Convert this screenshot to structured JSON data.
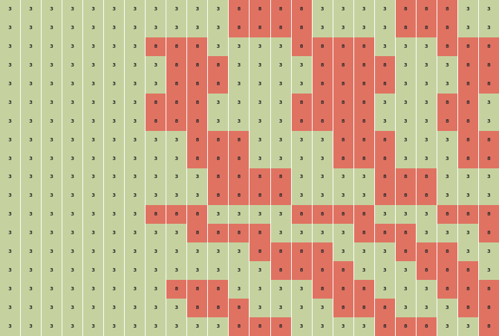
{
  "colors": {
    "value_3": "#c5d29f",
    "value_8": "#e07262"
  },
  "grid": {
    "rows": [
      [
        3,
        3,
        3,
        3,
        3,
        3,
        3,
        3,
        3,
        3,
        3,
        8,
        8,
        8,
        8,
        3,
        3,
        3,
        3,
        8,
        8,
        8,
        3,
        3
      ],
      [
        3,
        3,
        3,
        3,
        3,
        3,
        3,
        3,
        3,
        3,
        3,
        8,
        8,
        8,
        8,
        3,
        3,
        3,
        3,
        8,
        8,
        8,
        3,
        3
      ],
      [
        3,
        3,
        3,
        3,
        3,
        3,
        3,
        8,
        8,
        8,
        3,
        3,
        3,
        3,
        8,
        8,
        8,
        8,
        3,
        3,
        3,
        8,
        8,
        8
      ],
      [
        3,
        3,
        3,
        3,
        3,
        3,
        3,
        3,
        8,
        8,
        8,
        3,
        3,
        3,
        3,
        8,
        8,
        8,
        8,
        3,
        3,
        3,
        8,
        8
      ],
      [
        3,
        3,
        3,
        3,
        3,
        3,
        3,
        3,
        8,
        8,
        8,
        3,
        3,
        3,
        3,
        8,
        8,
        8,
        8,
        3,
        3,
        3,
        8,
        8
      ],
      [
        3,
        3,
        3,
        3,
        3,
        3,
        3,
        8,
        8,
        8,
        3,
        3,
        3,
        3,
        8,
        8,
        8,
        8,
        3,
        3,
        3,
        8,
        8,
        3
      ],
      [
        3,
        3,
        3,
        3,
        3,
        3,
        3,
        8,
        8,
        8,
        3,
        3,
        3,
        3,
        8,
        8,
        8,
        8,
        3,
        3,
        3,
        8,
        8,
        3
      ],
      [
        3,
        3,
        3,
        3,
        3,
        3,
        3,
        3,
        3,
        8,
        8,
        8,
        3,
        3,
        3,
        3,
        8,
        8,
        8,
        3,
        3,
        3,
        8,
        8
      ],
      [
        3,
        3,
        3,
        3,
        3,
        3,
        3,
        3,
        3,
        8,
        8,
        8,
        3,
        3,
        3,
        3,
        8,
        8,
        8,
        3,
        3,
        3,
        8,
        8
      ],
      [
        3,
        3,
        3,
        3,
        3,
        3,
        3,
        3,
        3,
        3,
        8,
        8,
        8,
        8,
        3,
        3,
        3,
        3,
        8,
        8,
        8,
        3,
        3,
        3
      ],
      [
        3,
        3,
        3,
        3,
        3,
        3,
        3,
        3,
        3,
        3,
        8,
        8,
        8,
        8,
        3,
        3,
        3,
        3,
        8,
        8,
        8,
        3,
        3,
        3
      ],
      [
        3,
        3,
        3,
        3,
        3,
        3,
        3,
        8,
        8,
        8,
        3,
        3,
        3,
        3,
        8,
        8,
        8,
        8,
        3,
        3,
        3,
        8,
        8,
        8
      ],
      [
        3,
        3,
        3,
        3,
        3,
        3,
        3,
        3,
        3,
        8,
        8,
        8,
        8,
        3,
        3,
        3,
        3,
        8,
        8,
        8,
        3,
        3,
        3,
        8
      ],
      [
        3,
        3,
        3,
        3,
        3,
        3,
        3,
        3,
        3,
        3,
        3,
        3,
        8,
        8,
        8,
        8,
        3,
        3,
        3,
        8,
        8,
        8,
        3,
        3
      ],
      [
        3,
        3,
        3,
        3,
        3,
        3,
        3,
        3,
        3,
        3,
        3,
        3,
        3,
        8,
        8,
        8,
        8,
        3,
        3,
        3,
        8,
        8,
        8,
        3
      ],
      [
        3,
        3,
        3,
        3,
        3,
        3,
        3,
        3,
        8,
        8,
        8,
        3,
        3,
        3,
        3,
        8,
        8,
        8,
        3,
        3,
        3,
        8,
        8,
        8
      ],
      [
        3,
        3,
        3,
        3,
        3,
        3,
        3,
        3,
        3,
        8,
        8,
        8,
        3,
        3,
        3,
        3,
        8,
        8,
        8,
        3,
        3,
        3,
        8,
        8
      ],
      [
        3,
        3,
        3,
        3,
        3,
        3,
        3,
        3,
        3,
        3,
        3,
        8,
        8,
        8,
        3,
        3,
        3,
        3,
        8,
        8,
        8,
        3,
        3,
        8
      ]
    ]
  }
}
